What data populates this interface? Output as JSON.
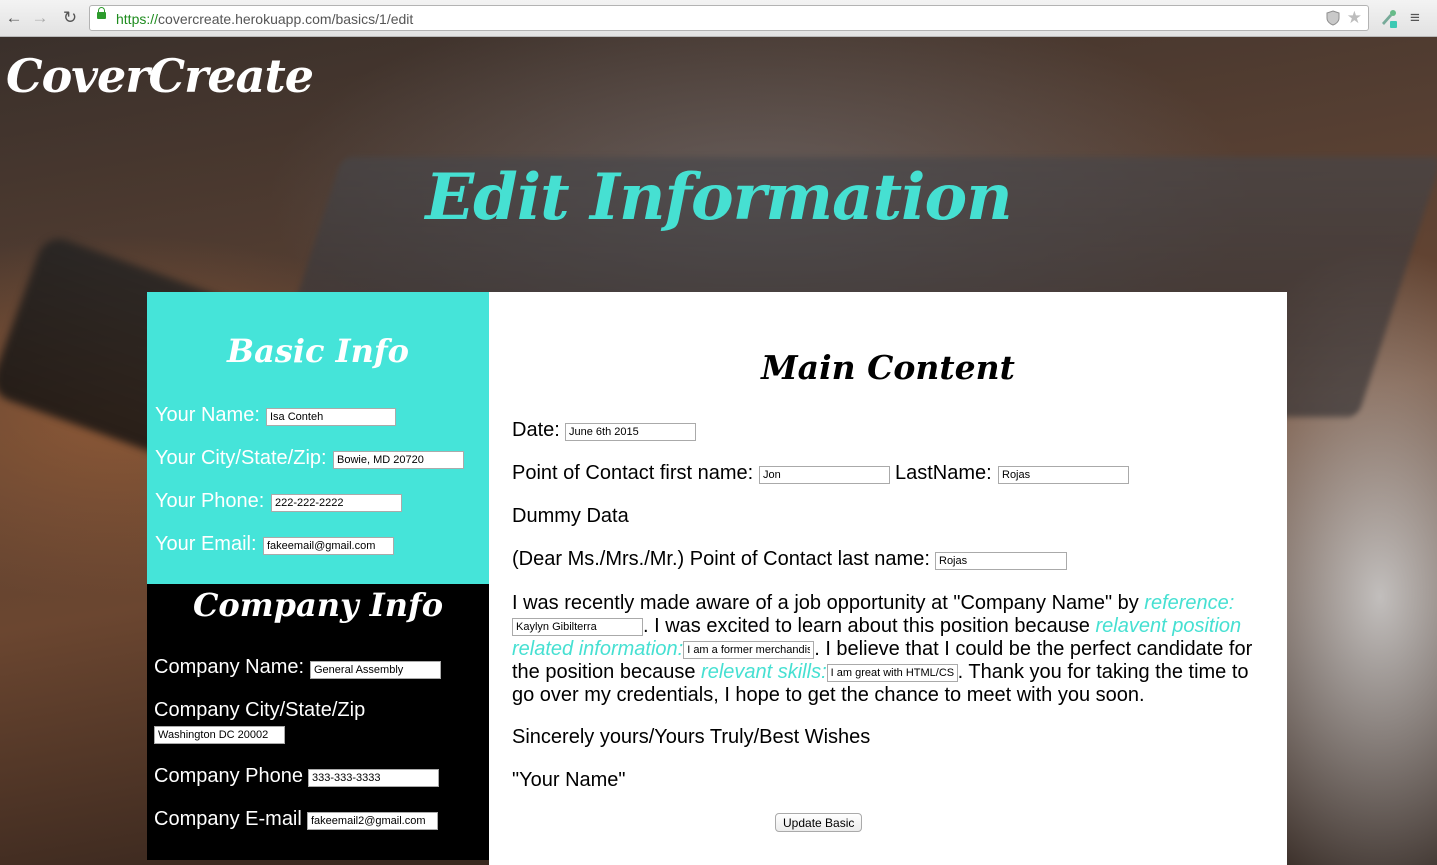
{
  "browser": {
    "url_scheme": "https://",
    "url_rest": "covercreate.herokuapp.com/basics/1/edit",
    "back_glyph": "←",
    "forward_glyph": "→",
    "reload_glyph": "↻",
    "star_glyph": "★",
    "menu_glyph": "≡"
  },
  "site": {
    "logo": "CoverCreate",
    "heading": "Edit Information",
    "accent_color": "#46e0d2"
  },
  "basic": {
    "title": "Basic Info",
    "name_label": "Your Name:",
    "name_value": "Isa Conteh",
    "city_label": "Your City/State/Zip:",
    "city_value": "Bowie, MD 20720",
    "phone_label": "Your Phone:",
    "phone_value": "222-222-2222",
    "email_label": "Your Email:",
    "email_value": "fakeemail@gmail.com"
  },
  "company": {
    "title": "Company Info",
    "name_label": "Company Name:",
    "name_value": "General Assembly",
    "city_label": "Company City/State/Zip",
    "city_value": "Washington DC 20002",
    "phone_label": "Company Phone",
    "phone_value": "333-333-3333",
    "email_label": "Company E-mail",
    "email_value": "fakeemail2@gmail.com"
  },
  "main": {
    "title": "Main Content",
    "date_label": "Date:",
    "date_value": "June 6th 2015",
    "contact_first_label": "Point of Contact first name:",
    "contact_first_value": "Jon",
    "contact_last_label": "LastName:",
    "contact_last_value": "Rojas",
    "dummy_text": "Dummy Data",
    "dear_label": "(Dear Ms./Mrs./Mr.) Point of Contact last name:",
    "dear_value": "Rojas",
    "para_1": "I was recently made aware of a job opportunity at \"Company Name\" by ",
    "ref_label": "reference:",
    "ref_value": "Kaylyn Gibilterra",
    "para_2": ". I was excited to learn about this position because ",
    "position_label": "relavent position related information:",
    "position_value": "I am a former merchandiser",
    "para_3": ". I believe that I could be the perfect candidate for the position because ",
    "skills_label": "relevant skills:",
    "skills_value": "I am great with HTML/CSS",
    "para_4": ". Thank you for taking the time to go over my credentials, I hope to get the chance to meet with you soon.",
    "closing": "Sincerely yours/Yours Truly/Best Wishes",
    "signature": "\"Your Name\"",
    "submit_label": "Update Basic"
  }
}
